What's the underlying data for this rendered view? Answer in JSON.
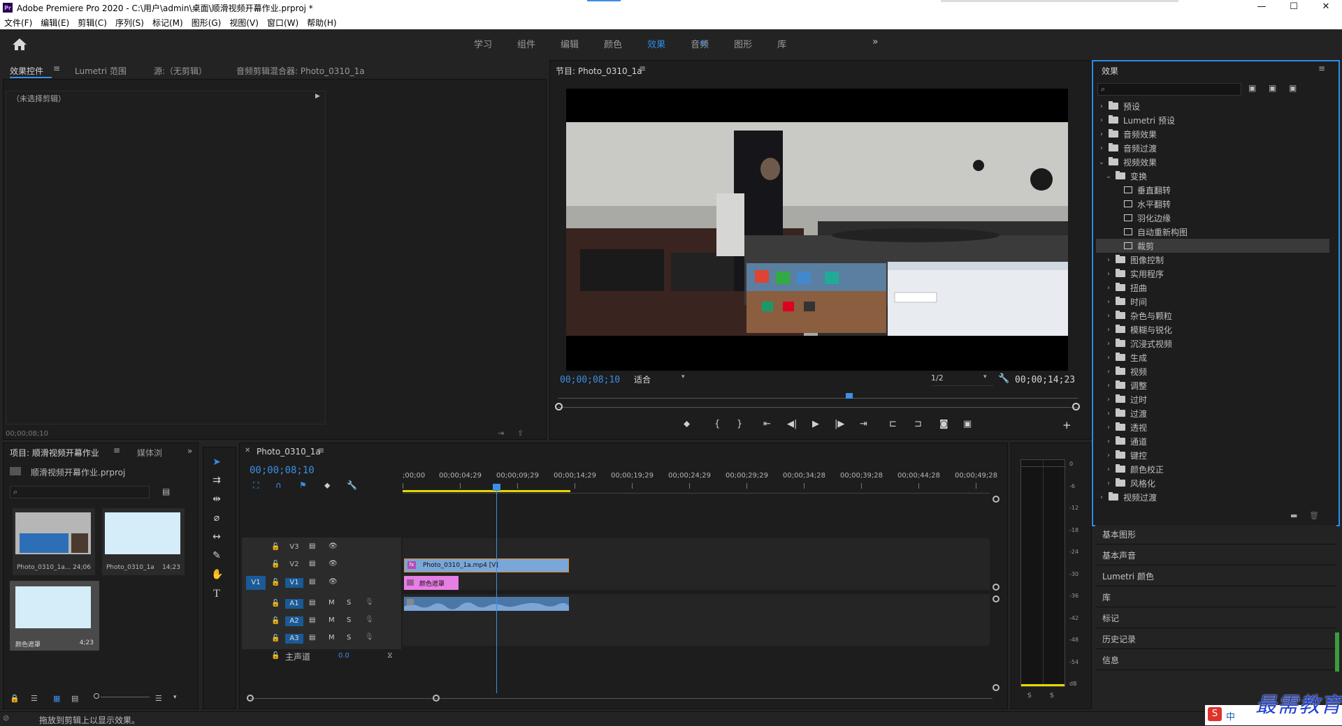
{
  "window": {
    "title": "Adobe Premiere Pro 2020 - C:\\用户\\admin\\桌面\\顺滑视频开幕作业.prproj *",
    "logo_text": "Pr",
    "btn_min": "—",
    "btn_max": "☐",
    "btn_close": "✕"
  },
  "menu": [
    "文件(F)",
    "编辑(E)",
    "剪辑(C)",
    "序列(S)",
    "标记(M)",
    "图形(G)",
    "视图(V)",
    "窗口(W)",
    "帮助(H)"
  ],
  "workspaces": [
    "学习",
    "组件",
    "编辑",
    "颜色",
    "效果",
    "音频",
    "图形",
    "库"
  ],
  "workspace_active": "效果",
  "workspace_more": "»",
  "source_panel": {
    "tabs": [
      "效果控件",
      "Lumetri 范围",
      "源:（无剪辑）",
      "音频剪辑混合器: Photo_0310_1a"
    ],
    "no_clip": "（未选择剪辑）",
    "timecode": "00;00;08;10"
  },
  "program": {
    "title": "节目: Photo_0310_1a",
    "current_tc": "00;00;08;10",
    "zoom": "适合",
    "resolution": "1/2",
    "duration_tc": "00;00;14;23",
    "playhead_fraction": 0.56
  },
  "project": {
    "tabs": [
      "项目: 顺滑视频开幕作业",
      "媒体浏"
    ],
    "file_name": "顺滑视频开幕作业.prproj",
    "items": [
      {
        "name": "Photo_0310_1a...",
        "duration": "24;06"
      },
      {
        "name": "Photo_0310_1a",
        "duration": "14;23"
      },
      {
        "name": "颜色遮罩",
        "duration": "4;23"
      }
    ]
  },
  "timeline": {
    "tab": "Photo_0310_1a",
    "timecode": "00;00;08;10",
    "ruler": [
      ";00;00",
      "00;00;04;29",
      "00;00;09;29",
      "00;00;14;29",
      "00;00;19;29",
      "00;00;24;29",
      "00;00;29;29",
      "00;00;34;28",
      "00;00;39;28",
      "00;00;44;28",
      "00;00;49;28"
    ],
    "video_tracks": [
      "V3",
      "V2",
      "V1"
    ],
    "audio_tracks": [
      "A1",
      "A2",
      "A3"
    ],
    "source_patch": "V1",
    "master": "主声道",
    "master_value": "0.0",
    "mute_label": "M",
    "solo_label": "S",
    "clip_video": "Photo_0310_1a.mp4 [V]",
    "clip_matte": "颜色遮罩",
    "fx_badge": "fx"
  },
  "meter": {
    "labels": [
      "0",
      "-6",
      "-12",
      "-18",
      "-24",
      "-30",
      "-36",
      "-42",
      "-48",
      "-54",
      "dB"
    ],
    "solo": [
      "S",
      "S"
    ]
  },
  "effects": {
    "title": "效果",
    "tree": [
      {
        "label": "预设",
        "level": 0,
        "type": "folder-preset",
        "open": false
      },
      {
        "label": "Lumetri 预设",
        "level": 0,
        "type": "folder-preset",
        "open": false
      },
      {
        "label": "音频效果",
        "level": 0,
        "type": "folder",
        "open": false
      },
      {
        "label": "音频过渡",
        "level": 0,
        "type": "folder",
        "open": false
      },
      {
        "label": "视频效果",
        "level": 0,
        "type": "folder",
        "open": true
      },
      {
        "label": "变换",
        "level": 1,
        "type": "folder",
        "open": true
      },
      {
        "label": "垂直翻转",
        "level": 2,
        "type": "effect"
      },
      {
        "label": "水平翻转",
        "level": 2,
        "type": "effect"
      },
      {
        "label": "羽化边缘",
        "level": 2,
        "type": "effect"
      },
      {
        "label": "自动重新构图",
        "level": 2,
        "type": "effect"
      },
      {
        "label": "裁剪",
        "level": 2,
        "type": "effect",
        "selected": true
      },
      {
        "label": "图像控制",
        "level": 1,
        "type": "folder"
      },
      {
        "label": "实用程序",
        "level": 1,
        "type": "folder"
      },
      {
        "label": "扭曲",
        "level": 1,
        "type": "folder"
      },
      {
        "label": "时间",
        "level": 1,
        "type": "folder"
      },
      {
        "label": "杂色与颗粒",
        "level": 1,
        "type": "folder"
      },
      {
        "label": "模糊与锐化",
        "level": 1,
        "type": "folder"
      },
      {
        "label": "沉浸式视频",
        "level": 1,
        "type": "folder"
      },
      {
        "label": "生成",
        "level": 1,
        "type": "folder"
      },
      {
        "label": "视频",
        "level": 1,
        "type": "folder"
      },
      {
        "label": "调整",
        "level": 1,
        "type": "folder"
      },
      {
        "label": "过时",
        "level": 1,
        "type": "folder"
      },
      {
        "label": "过渡",
        "level": 1,
        "type": "folder"
      },
      {
        "label": "透视",
        "level": 1,
        "type": "folder"
      },
      {
        "label": "通道",
        "level": 1,
        "type": "folder"
      },
      {
        "label": "键控",
        "level": 1,
        "type": "folder"
      },
      {
        "label": "颜色校正",
        "level": 1,
        "type": "folder"
      },
      {
        "label": "风格化",
        "level": 1,
        "type": "folder"
      },
      {
        "label": "视频过渡",
        "level": 0,
        "type": "folder",
        "open": false
      }
    ]
  },
  "side_panels": [
    "基本图形",
    "基本声音",
    "Lumetri 颜色",
    "库",
    "标记",
    "历史记录",
    "信息"
  ],
  "status": "拖放到剪辑上以显示效果。",
  "watermark": "最需教育",
  "ime_text": "中"
}
